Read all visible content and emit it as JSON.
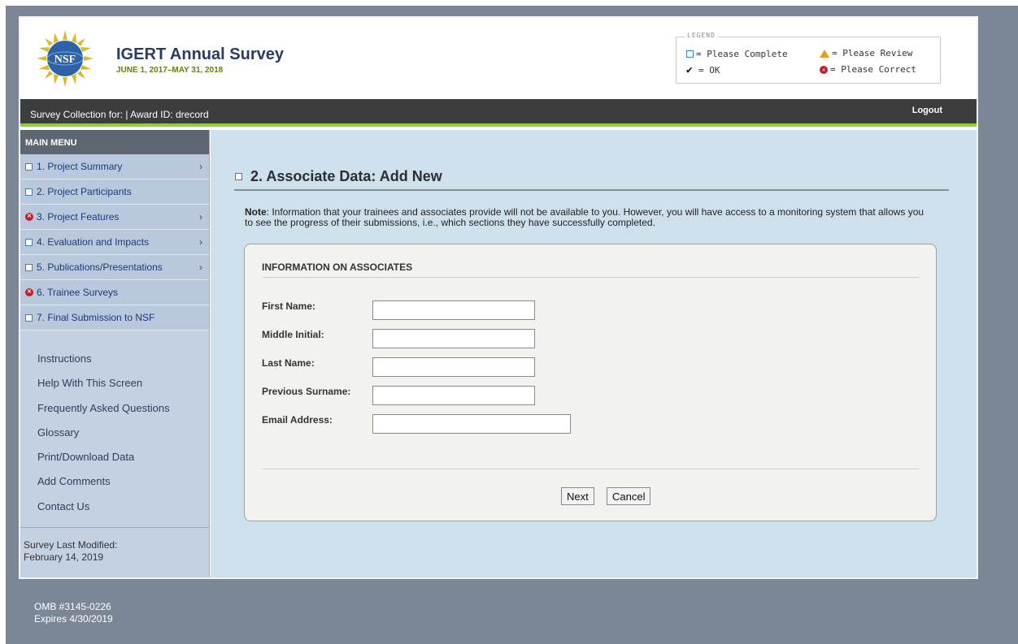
{
  "header": {
    "title": "IGERT Annual Survey",
    "dates": "JUNE 1, 2017–MAY 31, 2018",
    "logo_text": "NSF"
  },
  "legend": {
    "title": "LEGEND",
    "items": [
      {
        "icon": "square-icon",
        "label": "= Please Complete"
      },
      {
        "icon": "warning-icon",
        "label": "= Please Review"
      },
      {
        "icon": "checkmark-icon",
        "label": "= OK"
      },
      {
        "icon": "error-icon",
        "label": "= Please Correct"
      }
    ]
  },
  "topbar": {
    "award_text": "Survey Collection for: | Award ID: drecord",
    "logout": "Logout"
  },
  "sidebar": {
    "heading": "MAIN MENU",
    "items": [
      {
        "label": "1. Project Summary",
        "status": "complete",
        "has_submenu": true
      },
      {
        "label": "2. Project Participants",
        "status": "complete",
        "has_submenu": false
      },
      {
        "label": "3. Project Features",
        "status": "correct",
        "has_submenu": true
      },
      {
        "label": "4. Evaluation and Impacts",
        "status": "complete",
        "has_submenu": true
      },
      {
        "label": "5. Publications/Presentations",
        "status": "complete",
        "has_submenu": true
      },
      {
        "label": "6. Trainee Surveys",
        "status": "correct",
        "has_submenu": false
      },
      {
        "label": "7. Final Submission to NSF",
        "status": "complete",
        "has_submenu": false
      }
    ],
    "links": [
      "Instructions",
      "Help With This Screen",
      "Frequently Asked Questions",
      "Glossary",
      "Print/Download Data",
      "Add Comments",
      "Contact Us"
    ],
    "modified_label": "Survey Last Modified:",
    "modified_date": "February 14, 2019"
  },
  "main": {
    "heading": "2. Associate Data: Add New",
    "note_label": "Note",
    "note_text": ": Information that your trainees and associates provide will not be available to you. However, you will have access to a monitoring system that allows you to see the progress of their submissions, i.e., which sections they have successfully completed.",
    "section_title": "INFORMATION ON ASSOCIATES",
    "fields": [
      {
        "label": "First Name:",
        "value": ""
      },
      {
        "label": "Middle Initial:",
        "value": ""
      },
      {
        "label": "Last Name:",
        "value": ""
      },
      {
        "label": "Previous Surname:",
        "value": ""
      },
      {
        "label": "Email Address:",
        "value": ""
      }
    ],
    "next_button": "Next",
    "cancel_button": "Cancel"
  },
  "footer": {
    "omb": "OMB #3145-0226",
    "expires": "Expires 4/30/2019"
  },
  "colors": {
    "background": "#7b8797",
    "main_panel": "#cfe0ed",
    "sidebar": "#c3d1e3",
    "accent_green": "#8fcf30",
    "error_red": "#c0202a",
    "warning_orange": "#e89c1a"
  }
}
